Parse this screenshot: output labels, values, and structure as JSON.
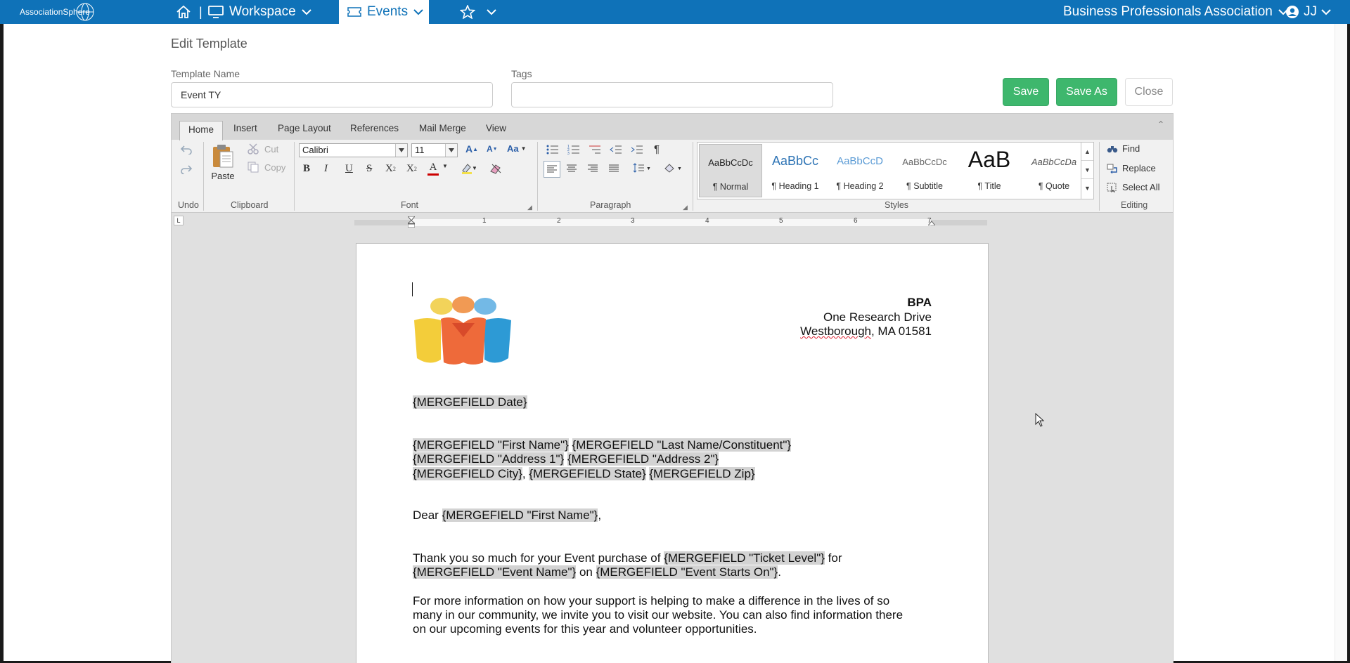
{
  "nav": {
    "logo_text": "AssociationSphere",
    "workspace_label": "Workspace",
    "events_label": "Events",
    "org_label": "Business Professionals Association",
    "user_initials": "JJ",
    "accent": "#0f72b8"
  },
  "page": {
    "title": "Edit Template"
  },
  "form": {
    "template_name_label": "Template Name",
    "template_name_value": "Event TY",
    "tags_label": "Tags",
    "tags_value": "",
    "save_label": "Save",
    "save_as_label": "Save As",
    "close_label": "Close",
    "button_color": "#3eb76d"
  },
  "ribbon": {
    "tabs": [
      "Home",
      "Insert",
      "Page Layout",
      "References",
      "Mail Merge",
      "View"
    ],
    "groups": {
      "undo": "Undo",
      "clipboard": "Clipboard",
      "font": "Font",
      "paragraph": "Paragraph",
      "styles": "Styles",
      "editing": "Editing"
    },
    "clipboard": {
      "paste": "Paste",
      "cut": "Cut",
      "copy": "Copy"
    },
    "font": {
      "family": "Calibri",
      "size": "11"
    },
    "styles": [
      {
        "sample": "AaBbCcDc",
        "name": "¶ Normal"
      },
      {
        "sample": "AaBbCc",
        "name": "¶ Heading 1"
      },
      {
        "sample": "AaBbCcD",
        "name": "¶ Heading 2"
      },
      {
        "sample": "AaBbCcDc",
        "name": "¶ Subtitle"
      },
      {
        "sample": "AaB",
        "name": "¶ Title"
      },
      {
        "sample": "AaBbCcDa",
        "name": "¶ Quote"
      }
    ],
    "editing": {
      "find": "Find",
      "replace": "Replace",
      "select_all": "Select All"
    }
  },
  "ruler": {
    "numbers": [
      "1",
      "2",
      "3",
      "4",
      "5",
      "6",
      "7"
    ]
  },
  "document": {
    "org_name": "BPA",
    "org_street": "One Research Drive",
    "org_city_word": "Westborough",
    "org_city_rest": ", MA 01581",
    "date_field": "{MERGEFIELD Date}",
    "first_name_field": "{MERGEFIELD \"First Name\"}",
    "last_name_field": "{MERGEFIELD \"Last Name/Constituent\"}",
    "address1_field": "{MERGEFIELD \"Address 1\"}",
    "address2_field": "{MERGEFIELD \"Address 2\"}",
    "city_field": "{MERGEFIELD City}",
    "comma": ", ",
    "state_field": "{MERGEFIELD State}",
    "zip_field": "{MERGEFIELD Zip}",
    "dear": "Dear ",
    "salutation_field": "{MERGEFIELD \"First Name\"}",
    "salutation_end": ",",
    "thanks_text": "Thank you so much for your Event purchase of ",
    "ticket_field": "{MERGEFIELD \"Ticket Level\"}",
    "for_text": " for",
    "event_name_field": "{MERGEFIELD \"Event Name\"}",
    "on_text": " on ",
    "event_starts_field": "{MERGEFIELD \"Event Starts On\"}",
    "period": ".",
    "info_line1": "For more information on how your support is helping to make a difference in the lives of so",
    "info_line2": "many in our community, we invite you to visit our website. You can also find information there",
    "info_line3": "on our upcoming events for this year and volunteer opportunities."
  }
}
